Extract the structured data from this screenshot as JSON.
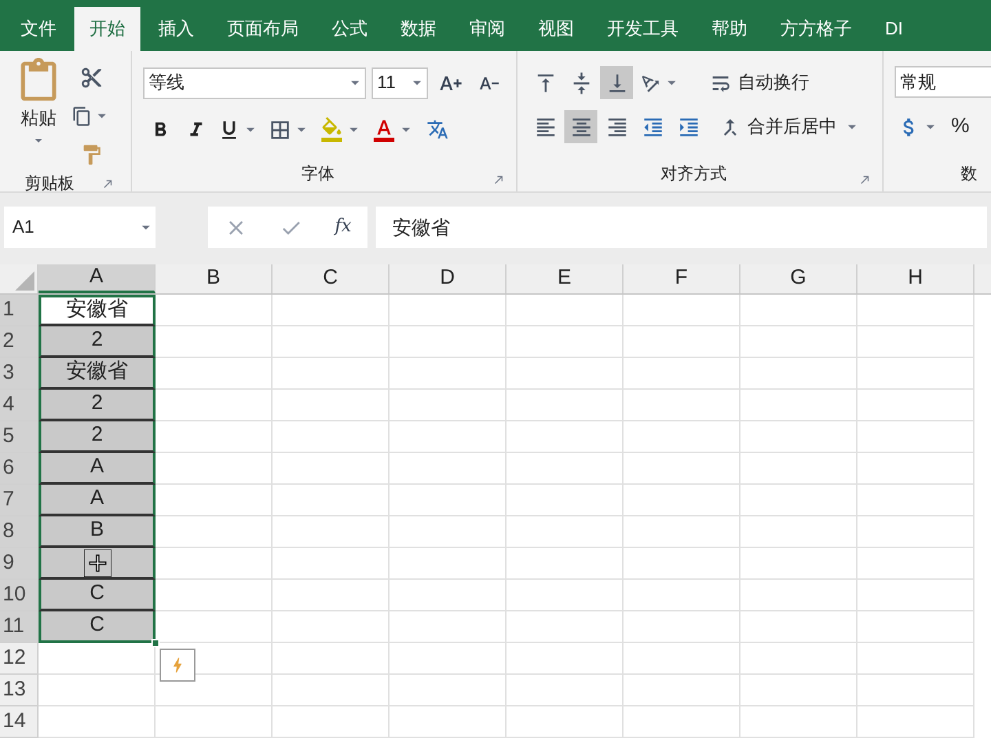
{
  "tabs": [
    {
      "label": "文件",
      "selected": false
    },
    {
      "label": "开始",
      "selected": true
    },
    {
      "label": "插入",
      "selected": false
    },
    {
      "label": "页面布局",
      "selected": false
    },
    {
      "label": "公式",
      "selected": false
    },
    {
      "label": "数据",
      "selected": false
    },
    {
      "label": "审阅",
      "selected": false
    },
    {
      "label": "视图",
      "selected": false
    },
    {
      "label": "开发工具",
      "selected": false
    },
    {
      "label": "帮助",
      "selected": false
    },
    {
      "label": "方方格子",
      "selected": false
    },
    {
      "label": "DI",
      "selected": false
    }
  ],
  "ribbon": {
    "clipboard": {
      "paste_label": "粘贴",
      "group_label": "剪贴板"
    },
    "font": {
      "name": "等线",
      "size": "11",
      "group_label": "字体"
    },
    "alignment": {
      "vertical": [
        {
          "selected": false
        },
        {
          "selected": false
        },
        {
          "selected": true
        }
      ],
      "horizontal": [
        {
          "selected": false
        },
        {
          "selected": true
        },
        {
          "selected": false
        }
      ],
      "wrap_label": "自动换行",
      "merge_label": "合并后居中",
      "group_label": "对齐方式"
    },
    "number": {
      "format": "常规",
      "percent": "%",
      "group_label": "数"
    }
  },
  "formula_bar": {
    "name_box": "A1",
    "function_label": "fx",
    "value": "安徽省"
  },
  "sheet": {
    "columns": [
      "A",
      "B",
      "C",
      "D",
      "E",
      "F",
      "G",
      "H"
    ],
    "rows": [
      {
        "label": "1",
        "value": "安徽省",
        "selected": true,
        "active": true,
        "cursor": false
      },
      {
        "label": "2",
        "value": "2",
        "selected": true,
        "active": false,
        "cursor": false
      },
      {
        "label": "3",
        "value": "安徽省",
        "selected": true,
        "active": false,
        "cursor": false
      },
      {
        "label": "4",
        "value": "2",
        "selected": true,
        "active": false,
        "cursor": false
      },
      {
        "label": "5",
        "value": "2",
        "selected": true,
        "active": false,
        "cursor": false
      },
      {
        "label": "6",
        "value": "A",
        "selected": true,
        "active": false,
        "cursor": false
      },
      {
        "label": "7",
        "value": "A",
        "selected": true,
        "active": false,
        "cursor": false
      },
      {
        "label": "8",
        "value": "B",
        "selected": true,
        "active": false,
        "cursor": false
      },
      {
        "label": "9",
        "selected": true,
        "active": false,
        "cursor": true
      },
      {
        "label": "10",
        "value": "C",
        "selected": true,
        "active": false,
        "cursor": false
      },
      {
        "label": "11",
        "value": "C",
        "selected": true,
        "active": false,
        "cursor": false
      },
      {
        "label": "12",
        "selected": false,
        "cursor": false
      },
      {
        "label": "13",
        "selected": false,
        "cursor": false
      },
      {
        "label": "14",
        "selected": false,
        "cursor": false
      }
    ]
  }
}
